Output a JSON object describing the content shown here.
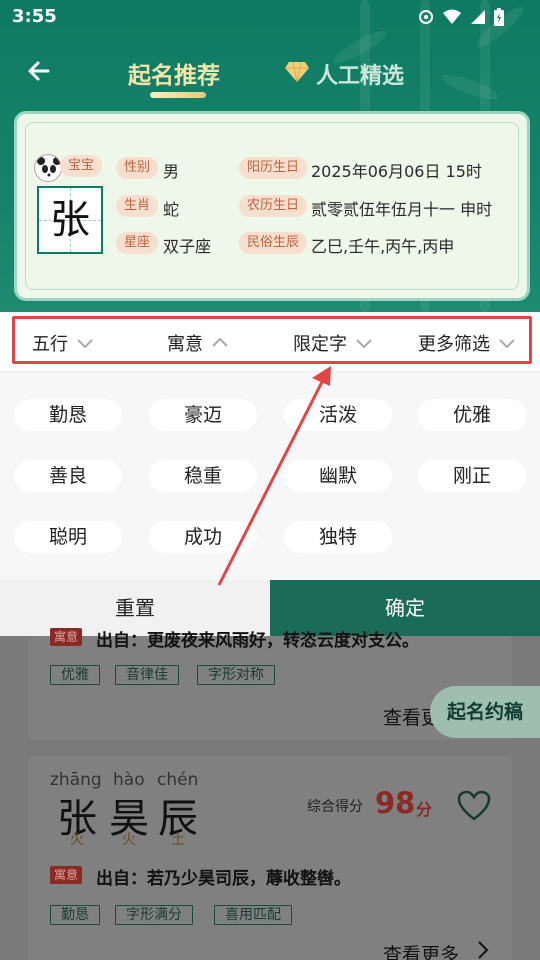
{
  "status_bar": {
    "time": "3:55"
  },
  "header": {
    "tab_active": "起名推荐",
    "tab_other": "人工精选"
  },
  "info": {
    "baby_label": "宝宝",
    "surname": "张",
    "gender_label": "性别",
    "gender": "男",
    "zodiac_label": "生肖",
    "zodiac": "蛇",
    "star_label": "星座",
    "star": "双子座",
    "solar_label": "阳历生日",
    "solar": "2025年06月06日 15时",
    "lunar_label": "农历生日",
    "lunar": "贰零贰伍年伍月十一 申时",
    "folk_label": "民俗生辰",
    "folk": "乙巳,壬午,丙午,丙申"
  },
  "filters": [
    "五行",
    "寓意",
    "限定字",
    "更多筛选"
  ],
  "tags": [
    "勤恳",
    "豪迈",
    "活泼",
    "优雅",
    "善良",
    "稳重",
    "幽默",
    "刚正",
    "聪明",
    "成功",
    "独特"
  ],
  "actions": {
    "reset": "重置",
    "confirm": "确定"
  },
  "list": {
    "card1": {
      "meaning_label": "寓意",
      "source": "出自：更废夜来风雨好，转恣云度对支公。",
      "chips": [
        "优雅",
        "音律佳",
        "字形对称"
      ],
      "more": "查看更多"
    },
    "card2": {
      "pinyin": [
        "zhāng",
        "hào",
        "chén"
      ],
      "chars": [
        "张",
        "昊",
        "辰"
      ],
      "elements": [
        "火",
        "火",
        "土"
      ],
      "score_label": "综合得分",
      "score": "98",
      "score_unit": "分",
      "meaning_label": "寓意",
      "source": "出自：若乃少昊司辰，蓐收整辔。",
      "chips": [
        "勤恳",
        "字形满分",
        "喜用匹配"
      ],
      "more": "查看更多"
    }
  },
  "float_button": "起名约稿",
  "colors": {
    "brand_green": "#0f7a63",
    "highlight_red": "#e04646",
    "gold": "#f4e4a8"
  }
}
